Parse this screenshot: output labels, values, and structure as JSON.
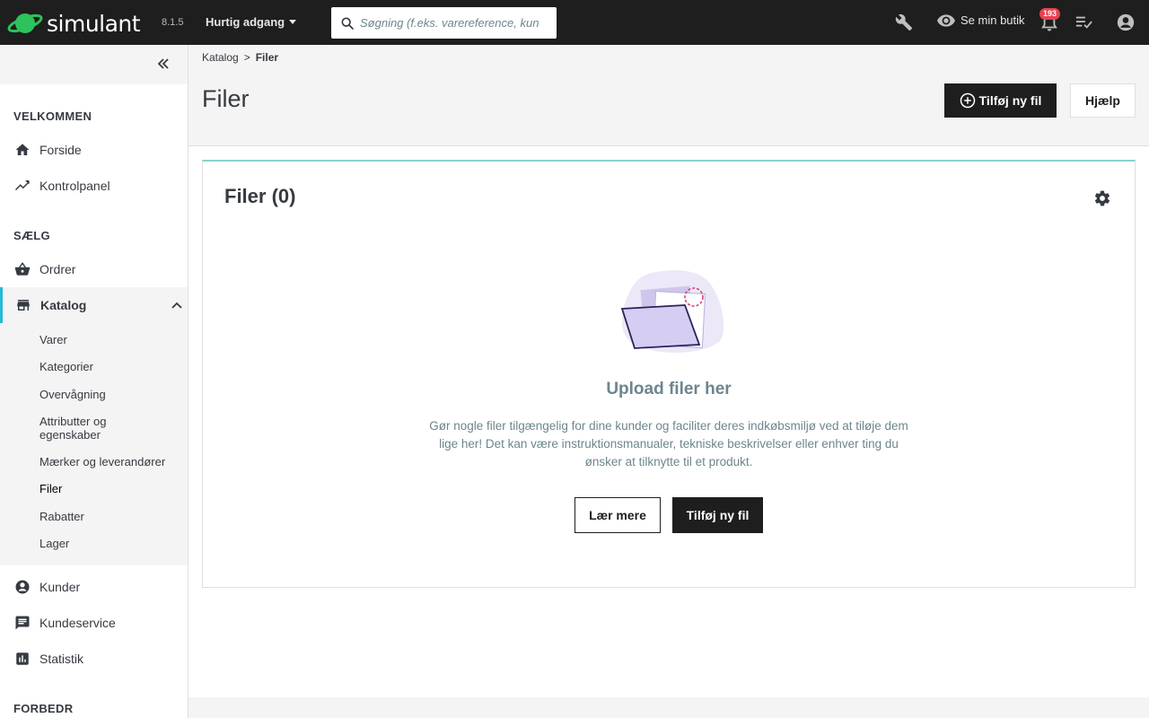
{
  "header": {
    "brand": "simulant",
    "version": "8.1.5",
    "quick_access": "Hurtig adgang",
    "search_placeholder": "Søgning (f.eks. varereference, kundenavn…)",
    "view_shop": "Se min butik",
    "notifications_count": "193",
    "brand_color": "#2ec25c",
    "icons": [
      "search-icon",
      "wrench-icon",
      "eye-icon",
      "bell-icon",
      "checklist-icon",
      "account-icon"
    ]
  },
  "sidebar": {
    "collapse_icon": "double-chevron-left-icon",
    "sections": {
      "welcome": "VELKOMMEN",
      "sell": "SÆLG",
      "improve": "FORBEDR"
    },
    "items": {
      "home": "Forside",
      "dashboard": "Kontrolpanel",
      "orders": "Ordrer",
      "catalog": "Katalog",
      "customers": "Kunder",
      "customer_service": "Kundeservice",
      "stats": "Statistik"
    },
    "catalog_sub": [
      "Varer",
      "Kategorier",
      "Overvågning",
      "Attributter og egenskaber",
      "Mærker og leverandører",
      "Filer",
      "Rabatter",
      "Lager"
    ],
    "active_accent": "#25b9d7"
  },
  "breadcrumb": {
    "parent": "Katalog",
    "separator": ">",
    "current": "Filer"
  },
  "page": {
    "title": "Filer",
    "add_button": "Tilføj ny fil",
    "help_button": "Hjælp"
  },
  "card": {
    "title": "Filer (0)",
    "empty_title": "Upload filer her",
    "empty_description": "Gør nogle filer tilgængelig for dine kunder og faciliter deres indkøbsmiljø ved at tiløje dem lige her! Det kan være instruktionsmanualer, tekniske beskrivelser eller enhver ting du ønsker at tilknytte til et produkt.",
    "learn_more": "Lær mere",
    "add_file": "Tilføj ny fil",
    "accent": "#8bd0cd"
  }
}
